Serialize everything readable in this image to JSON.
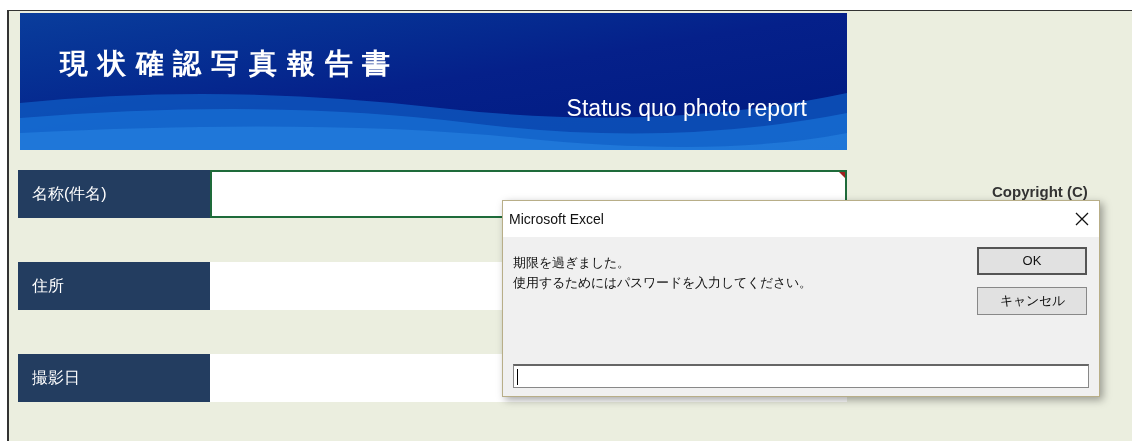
{
  "banner": {
    "title_ja": "現状確認写真報告書",
    "title_en": "Status quo photo report"
  },
  "fields": [
    {
      "label": "名称(件名)",
      "focused": true
    },
    {
      "label": "住所",
      "focused": false
    },
    {
      "label": "撮影日",
      "focused": false
    }
  ],
  "copyright": "Copyright (C)",
  "dialog": {
    "title": "Microsoft Excel",
    "message_lines": [
      "期限を過ぎました。",
      "使用するためにはパスワードを入力してください。"
    ],
    "buttons": [
      {
        "label": "OK",
        "default": true
      },
      {
        "label": "キャンセル",
        "default": false
      }
    ]
  }
}
